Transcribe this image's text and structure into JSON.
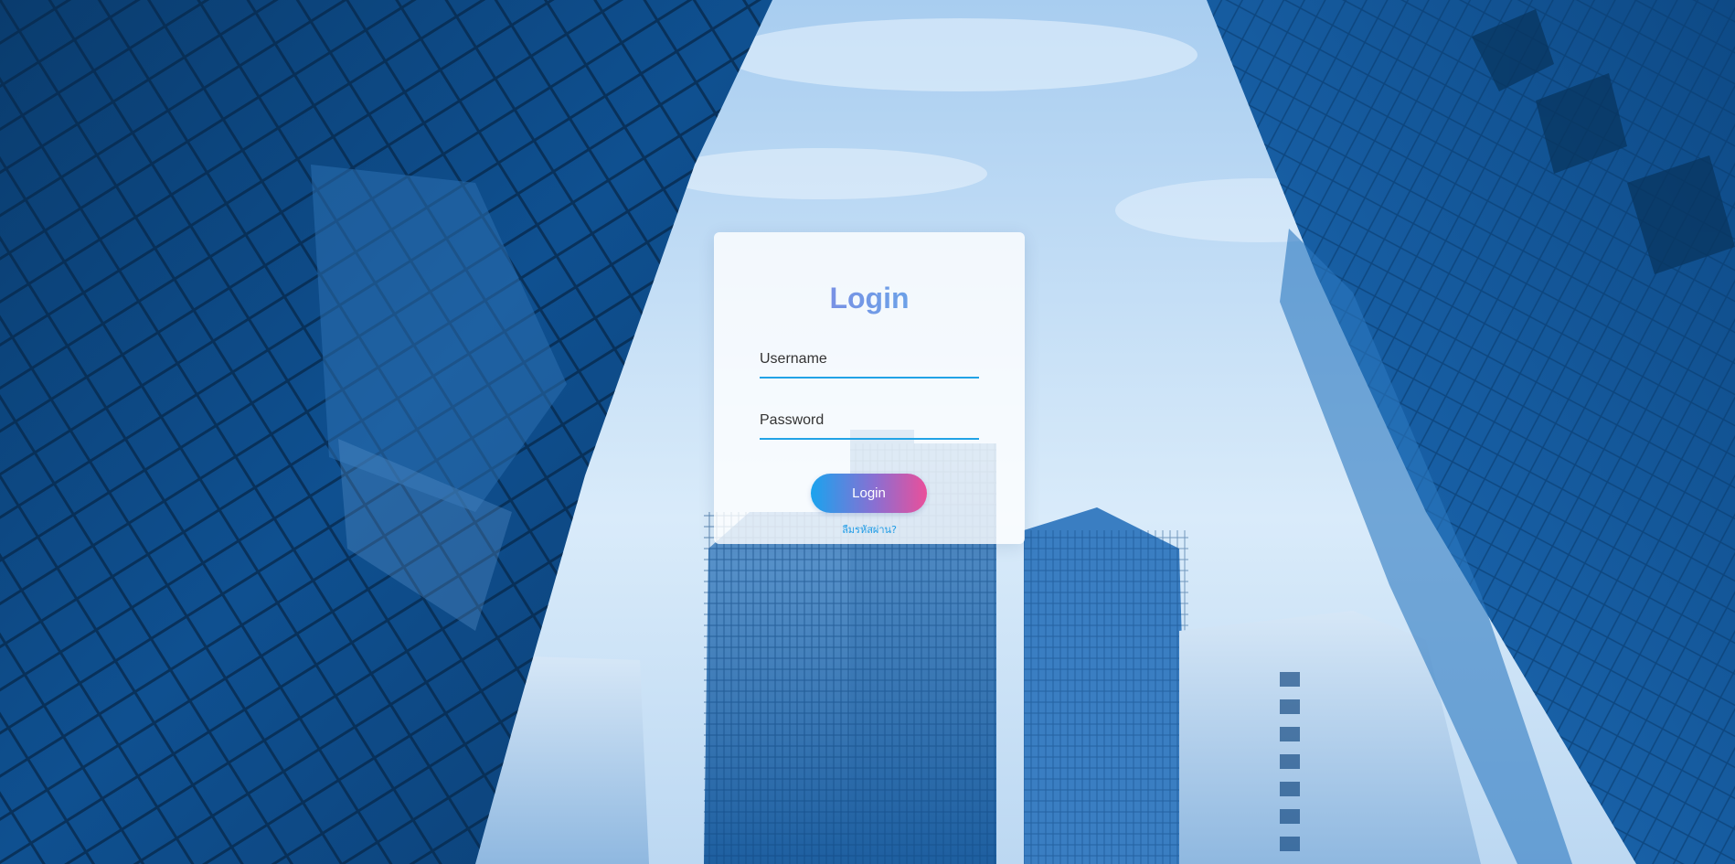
{
  "login": {
    "title": "Login",
    "username_placeholder": "Username",
    "password_placeholder": "Password",
    "submit_label": "Login",
    "forgot_password": "ลืมรหัสผ่าน?"
  },
  "colors": {
    "accent": "#22a3e6",
    "button_gradient_start": "#1aa3ee",
    "button_gradient_end": "#ea4f9a",
    "title_gradient_start": "#8a7be0",
    "title_gradient_end": "#5ab8ec"
  }
}
